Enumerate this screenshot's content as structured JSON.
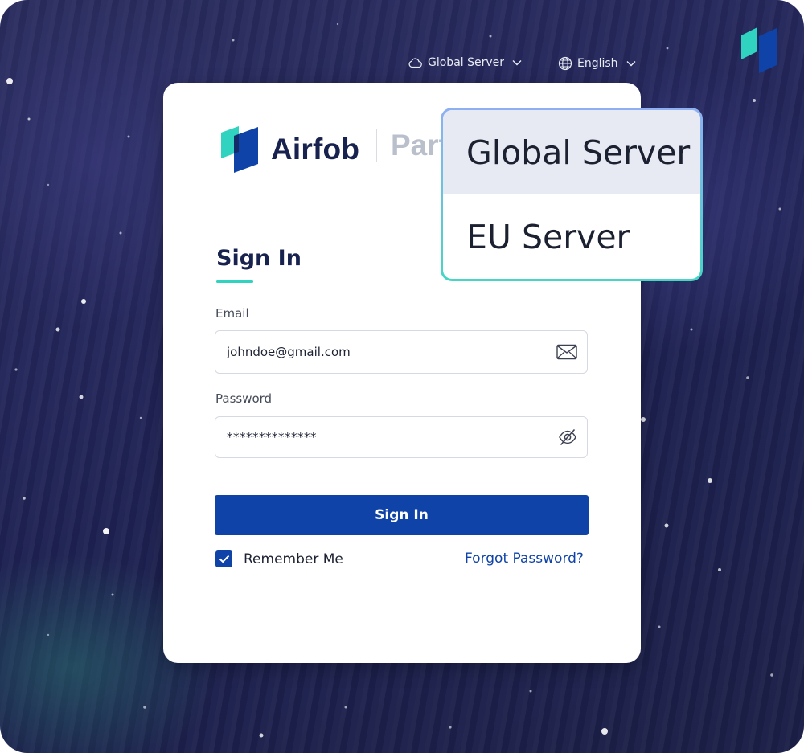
{
  "topbar": {
    "server_label": "Global Server",
    "language_label": "English"
  },
  "logo": {
    "name": "Airfob",
    "subtitle": "Partner"
  },
  "signin": {
    "title": "Sign In",
    "email_label": "Email",
    "email_value": "johndoe@gmail.com",
    "password_label": "Password",
    "password_value": "**************",
    "button_label": "Sign In",
    "remember_label": "Remember Me",
    "remember_checked": true,
    "forgot_label": "Forgot Password?"
  },
  "server_dropdown": {
    "options": [
      {
        "label": "Global Server",
        "selected": true
      },
      {
        "label": "EU Server",
        "selected": false
      }
    ]
  },
  "colors": {
    "primary": "#0f43a8",
    "accent": "#2fd3c0",
    "navy_text": "#17224e"
  }
}
